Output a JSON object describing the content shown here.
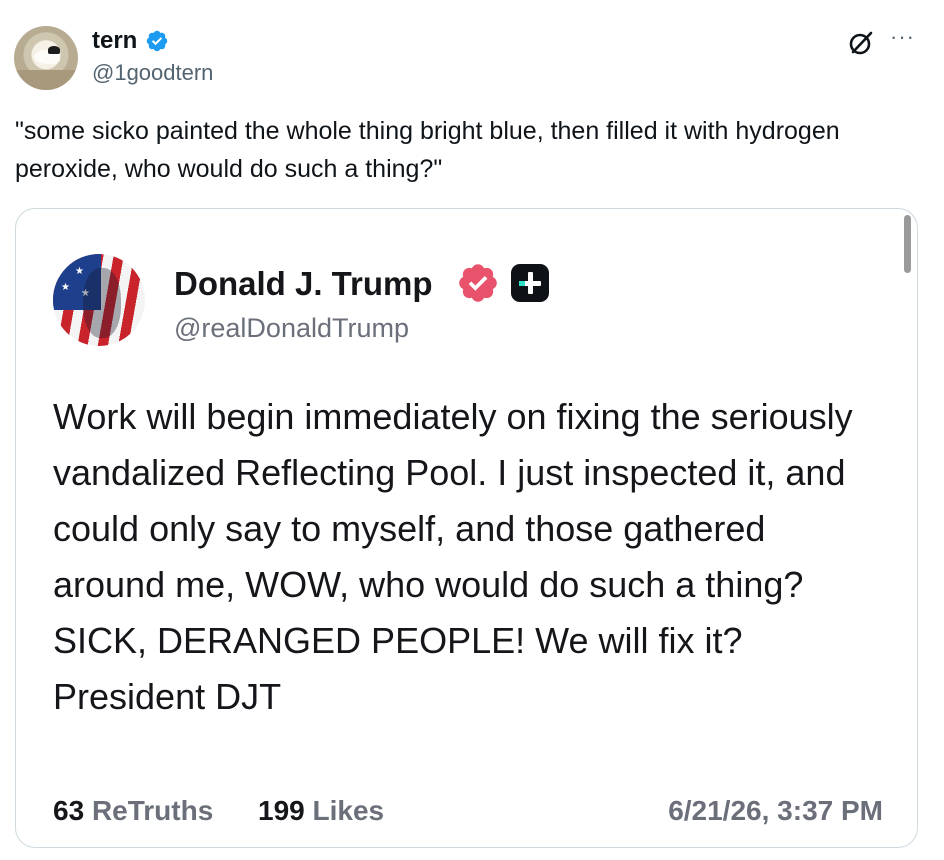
{
  "author": {
    "name": "tern",
    "handle": "@1goodtern"
  },
  "post_text": "\"some sicko painted the whole thing bright blue, then filled it with hydrogen peroxide, who would do such a thing?\"",
  "embedded_post": {
    "name": "Donald J. Trump",
    "handle": "@realDonaldTrump",
    "text": "Work will begin immediately on fixing the seriously vandalized Reflecting Pool. I just inspected it, and could only say to myself, and those gathered around me, WOW, who would do such a thing? SICK, DERANGED PEOPLE! We will fix it? President DJT",
    "retruths_count": "63",
    "retruths_label": "ReTruths",
    "likes_count": "199",
    "likes_label": "Likes",
    "timestamp": "6/21/26, 3:37 PM"
  },
  "icons": {
    "verified": "verified-badge-icon",
    "grok": "grok-icon",
    "more": "more-icon",
    "truth_badge": "truth-verified-icon",
    "plus": "truth-plus-icon"
  },
  "colors": {
    "verified_blue": "#1d9bf0",
    "truth_badge_pink": "#e8536b",
    "muted_text": "#536471"
  }
}
